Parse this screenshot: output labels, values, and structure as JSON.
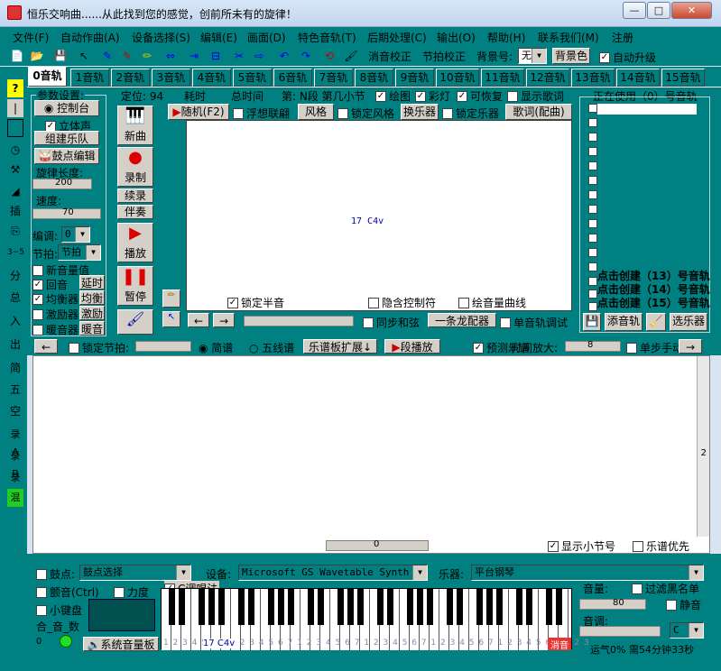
{
  "window": {
    "title": "恒乐交响曲......从此找到您的感觉，创前所未有的旋律！",
    "min": "—",
    "max": "□",
    "close": "✕"
  },
  "menu": [
    "文件(F)",
    "自动作曲(A)",
    "设备选择(S)",
    "编辑(E)",
    "画面(D)",
    "特色音轨(T)",
    "后期处理(C)",
    "输出(O)",
    "帮助(H)",
    "联系我们(M)",
    "注册"
  ],
  "toolbar": {
    "volume_calib": "消音校正",
    "beat_calib": "节拍校正",
    "bg_label": "背景号:",
    "bg_value": "无",
    "bg_color": "背景色",
    "auto_upgrade": "自动升级"
  },
  "tabs": [
    "0音轨",
    "1音轨",
    "2音轨",
    "3音轨",
    "4音轨",
    "5音轨",
    "6音轨",
    "7音轨",
    "8音轨",
    "9音轨",
    "10音轨",
    "11音轨",
    "12音轨",
    "13音轨",
    "14音轨",
    "15音轨"
  ],
  "sidebar": [
    "?",
    "插",
    "分",
    "总",
    "入",
    "出",
    "简",
    "五",
    "空",
    "录A",
    "录B",
    "录C",
    "混"
  ],
  "params": {
    "title": "参数设置:",
    "console": "控制台",
    "stereo": "立体声",
    "band": "组建乐队",
    "drum_edit": "鼓点编辑",
    "melody_len": "旋律长度:",
    "melody_val": "200",
    "speed": "速度:",
    "speed_val": "70",
    "key": "编调:",
    "key_val": "0",
    "beat": "节拍:",
    "beat_val": "节拍",
    "new_vol": "新音量值",
    "echo": "回音",
    "delay": "延时",
    "equalizer": "均衡器",
    "balance": "均衡",
    "exciter": "激励器",
    "excite": "激励",
    "warmer": "暖音器",
    "warm": "暖音"
  },
  "center": {
    "position": "定位: 94",
    "elapsed": "耗时",
    "total": "总时间",
    "section": "第: N段 第几小节",
    "draw": "绘图",
    "color_light": "彩灯",
    "recoverable": "可恢复",
    "show_lyrics": "显示歌词",
    "random": "随机(F2)",
    "assoc": "浮想联翩",
    "style": "风格",
    "lock_style": "锁定风格",
    "change_inst": "换乐器",
    "lock_inst": "锁定乐器",
    "lyrics_match": "歌词(配曲)",
    "note_text": "17 C4v",
    "lock_half": "锁定半音",
    "hidden_ctrl": "隐含控制符",
    "draw_vol_curve": "绘音量曲线",
    "sync_chord": "同步和弦",
    "dragon": "一条龙配器",
    "single_debug": "单音轨调试"
  },
  "actions": {
    "new": "新曲",
    "record": "录制",
    "continue": "续录",
    "accompany": "伴奏",
    "play": "播放",
    "pause": "暂停"
  },
  "vert": {
    "a": "12",
    "b": "1",
    "c": "1",
    "d": "12"
  },
  "tracklist": {
    "title": "正在使用（0）号音轨",
    "create13": "点击创建（13）号音轨",
    "create14": "点击创建（14）号音轨",
    "create15": "点击创建（15）号音轨",
    "add": "添音轨",
    "select": "选乐器"
  },
  "bar2": {
    "lock_beat": "锁定节拍:",
    "simple": "简谱",
    "staff": "五线谱",
    "expand": "乐谱板扩展↓",
    "seg_play": "段播放",
    "predict": "预测乐谱",
    "time_zoom": "时间放大:",
    "zoom_val": "8",
    "step": "单步手动"
  },
  "editor": {
    "side_num": "2",
    "scroll_val": "0",
    "show_bar": "显示小节号",
    "score_first": "乐谱优先"
  },
  "bottom": {
    "drum": "鼓点:",
    "drum_sel": "鼓点选择",
    "device": "设备:",
    "device_val": "Microsoft GS Wavetable Synth",
    "instrument": "乐器:",
    "inst_val": "平台钢琴",
    "chord_mode": "C调唱法",
    "vibrato": "颤音(Ctrl)",
    "force": "力度",
    "mini_kb": "小键盘",
    "he_yin_shu": "合_音_数",
    "zero": "0",
    "sys_vol": "系统音量板",
    "kb_label": "17 C4v",
    "mute": "消音",
    "volume": "音量:",
    "vol_val": "80",
    "filter_black": "过滤黑名单",
    "silent": "静音",
    "pitch": "音调:",
    "key_sel": "C",
    "status": "运气0% 需54分钟33秒",
    "digits": "1 2 3 4 5 6 7 1 2 3 4 5 6 7 1 2 3 4 5 6 7 1 2 3 4 5 6 7 1 2 3 4 5 6 7 1 2 3 4 5 6 7 1 2 3"
  }
}
